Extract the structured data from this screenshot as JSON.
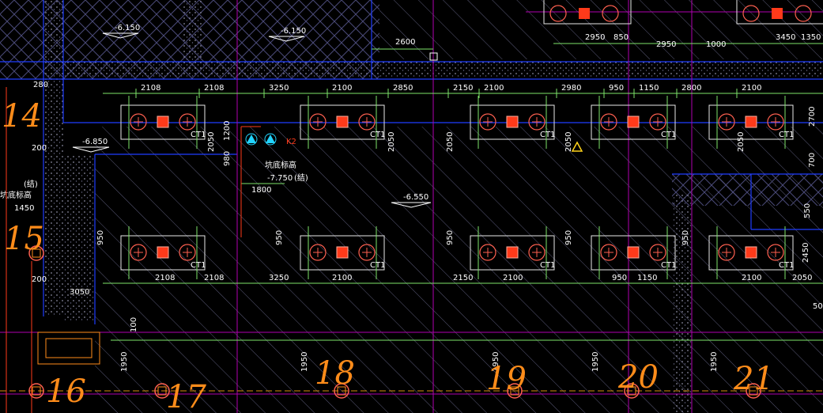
{
  "colors": {
    "background": "#000000",
    "axis": "#1f3cff",
    "grid_magenta": "#b000b0",
    "dim_green": "#7ee36a",
    "hatch": "#6a6a8a",
    "pile_red": "#ff3a1a",
    "handwriting": "#ff8c1a",
    "cyan_mark": "#22d4ff",
    "yellow_mark": "#ffd21a"
  },
  "elevations": {
    "top_left": "-6.150",
    "top_mid": "-6.150",
    "left": "-6.850",
    "center": "-6.550",
    "pit": "-7.750"
  },
  "top_row_dims": [
    "2108",
    "2108",
    "3250",
    "2100",
    "2850",
    "2150",
    "2100",
    "2980",
    "950",
    "1150",
    "2800",
    "2100"
  ],
  "bottom_row_dims": [
    "2108",
    "2108",
    "3250",
    "2100",
    "2150",
    "2100",
    "950",
    "1150",
    "2100",
    "2050"
  ],
  "upper_dims": [
    "2600",
    "2950",
    "850",
    "2950",
    "1000",
    "3450",
    "1350"
  ],
  "vertical_dims": [
    "2050",
    "1200",
    "980",
    "2050",
    "2050",
    "2050",
    "2050",
    "2700",
    "700",
    "950",
    "950",
    "950",
    "950",
    "950",
    "550",
    "2450",
    "1950",
    "1950",
    "1950",
    "1950",
    "1950",
    "100"
  ],
  "misc_dims": [
    "280",
    "200",
    "200",
    "1450",
    "3050",
    "1800",
    "50"
  ],
  "cap_label": "CT1",
  "pit_note": "坑底标高",
  "pit_note_suffix": "(结)",
  "left_note": "坑底标高",
  "left_note_suffix": "(结)",
  "k_label": "K2",
  "handwritten_numbers": [
    "14",
    "15",
    "16",
    "17",
    "18",
    "19",
    "20",
    "21"
  ]
}
